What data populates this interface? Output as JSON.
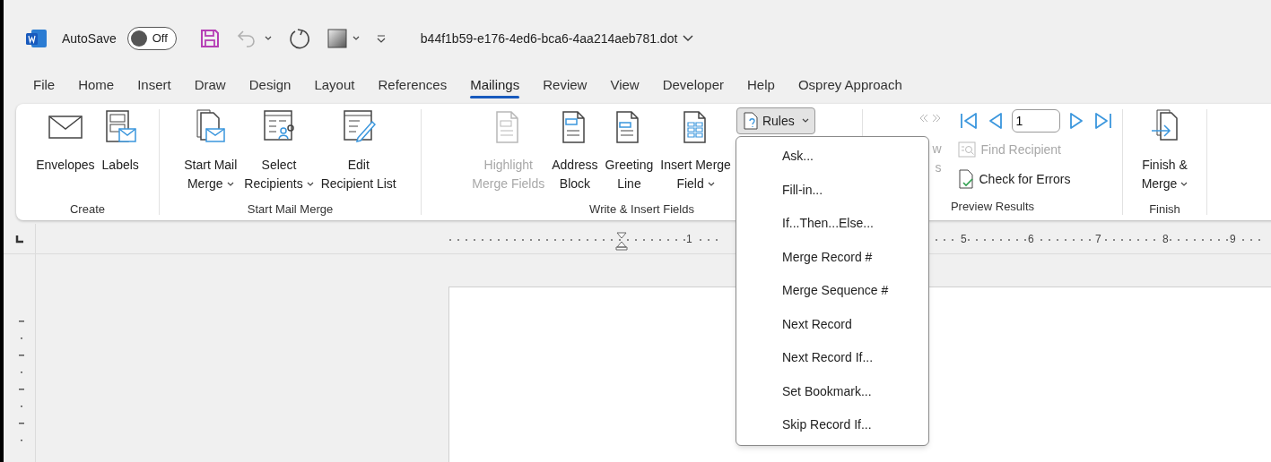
{
  "title_bar": {
    "autosave": {
      "label": "AutoSave",
      "state_text": "Off",
      "on": false
    },
    "quick_access": [
      {
        "kind": "save",
        "disabled": false
      },
      {
        "kind": "undo",
        "disabled": true
      },
      {
        "kind": "redo",
        "disabled": false
      },
      {
        "kind": "shape",
        "disabled": false
      },
      {
        "kind": "customize",
        "disabled": false
      }
    ],
    "filename": "b44f1b59-e176-4ed6-bca6-4aa214aeb781.dot"
  },
  "tabs": [
    {
      "label": "File",
      "selected": false
    },
    {
      "label": "Home",
      "selected": false
    },
    {
      "label": "Insert",
      "selected": false
    },
    {
      "label": "Draw",
      "selected": false
    },
    {
      "label": "Design",
      "selected": false
    },
    {
      "label": "Layout",
      "selected": false
    },
    {
      "label": "References",
      "selected": false
    },
    {
      "label": "Mailings",
      "selected": true
    },
    {
      "label": "Review",
      "selected": false
    },
    {
      "label": "View",
      "selected": false
    },
    {
      "label": "Developer",
      "selected": false
    },
    {
      "label": "Help",
      "selected": false
    },
    {
      "label": "Osprey Approach",
      "selected": false
    }
  ],
  "ribbon": {
    "groups": [
      {
        "label": "Create",
        "items": [
          {
            "kind": "envelope",
            "lines": [
              "Envelopes"
            ],
            "disabled": false,
            "dropdown": false
          },
          {
            "kind": "labels",
            "lines": [
              "Labels"
            ],
            "disabled": false,
            "dropdown": false
          }
        ]
      },
      {
        "label": "Start Mail Merge",
        "items": [
          {
            "kind": "startmerge",
            "lines": [
              "Start Mail",
              "Merge"
            ],
            "disabled": false,
            "dropdown": true
          },
          {
            "kind": "recipients",
            "lines": [
              "Select",
              "Recipients"
            ],
            "disabled": false,
            "dropdown": true
          },
          {
            "kind": "editlist",
            "lines": [
              "Edit",
              "Recipient List"
            ],
            "disabled": false,
            "dropdown": false
          }
        ]
      },
      {
        "label": "Write & Insert Fields",
        "items": [
          {
            "kind": "highlight",
            "lines": [
              "Highlight",
              "Merge Fields"
            ],
            "disabled": true,
            "dropdown": false
          },
          {
            "kind": "address",
            "lines": [
              "Address",
              "Block"
            ],
            "disabled": false,
            "dropdown": false
          },
          {
            "kind": "greeting",
            "lines": [
              "Greeting",
              "Line"
            ],
            "disabled": false,
            "dropdown": false
          },
          {
            "kind": "mergefield",
            "lines": [
              "Insert Merge",
              "Field"
            ],
            "disabled": false,
            "dropdown": true
          },
          {
            "kind": "rules",
            "label": "Rules",
            "expanded": true
          }
        ]
      },
      {
        "label": "Preview Results",
        "items": [
          {
            "kind": "covered",
            "lines": [
              "w",
              "s"
            ]
          },
          {
            "kind": "nav",
            "record": "1",
            "find": {
              "label": "Find Recipient",
              "disabled": true
            },
            "check": {
              "label": "Check for Errors",
              "disabled": false
            }
          }
        ]
      },
      {
        "label": "Finish",
        "items": [
          {
            "kind": "finish",
            "lines": [
              "Finish &",
              "Merge"
            ],
            "disabled": false,
            "dropdown": true
          }
        ]
      }
    ]
  },
  "rules_menu": [
    {
      "label": "Ask..."
    },
    {
      "label": "Fill-in..."
    },
    {
      "label": "If...Then...Else..."
    },
    {
      "label": "Merge Record #"
    },
    {
      "label": "Merge Sequence #"
    },
    {
      "label": "Next Record"
    },
    {
      "label": "Next Record If..."
    },
    {
      "label": "Set Bookmark..."
    },
    {
      "label": "Skip Record If..."
    }
  ],
  "ruler": {
    "numbers": [
      "1",
      "5",
      "6",
      "7",
      "8",
      "9"
    ]
  }
}
